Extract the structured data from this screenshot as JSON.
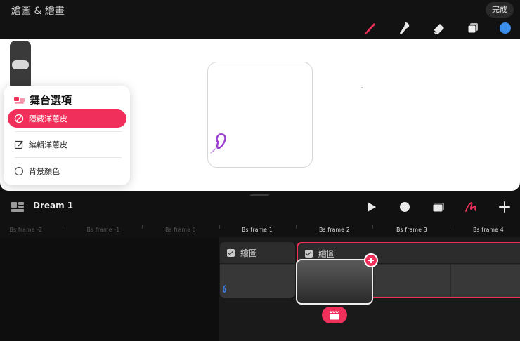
{
  "app": {
    "title": "繪圖 & 繪畫",
    "done_label": "完成"
  },
  "toolbar": {
    "tools": [
      "brush-icon",
      "smudge-icon",
      "eraser-icon",
      "layers-icon",
      "color-swatch"
    ],
    "brush_color": "#f0305a",
    "swatch_color": "#3a8de8"
  },
  "stage_popup": {
    "title": "舞台選項",
    "options": [
      {
        "label": "隱藏洋蔥皮",
        "icon": "onion-icon",
        "active": true
      },
      {
        "label": "編輯洋蔥皮",
        "icon": "edit-icon",
        "active": false
      },
      {
        "label": "背景顏色",
        "icon": "circle-icon",
        "active": false
      }
    ]
  },
  "timeline": {
    "project_name": "Dream 1",
    "frames": [
      "Bs frame -2",
      "Bs frame -1",
      "Bs frame 0",
      "Bs frame 1",
      "Bs frame 2",
      "Bs frame 3",
      "Bs frame 4"
    ],
    "tracks": [
      {
        "name": "繪圖"
      },
      {
        "name": "繪圖"
      }
    ]
  },
  "colors": {
    "accent": "#f0305a",
    "scribble": "#9b3fd0"
  }
}
